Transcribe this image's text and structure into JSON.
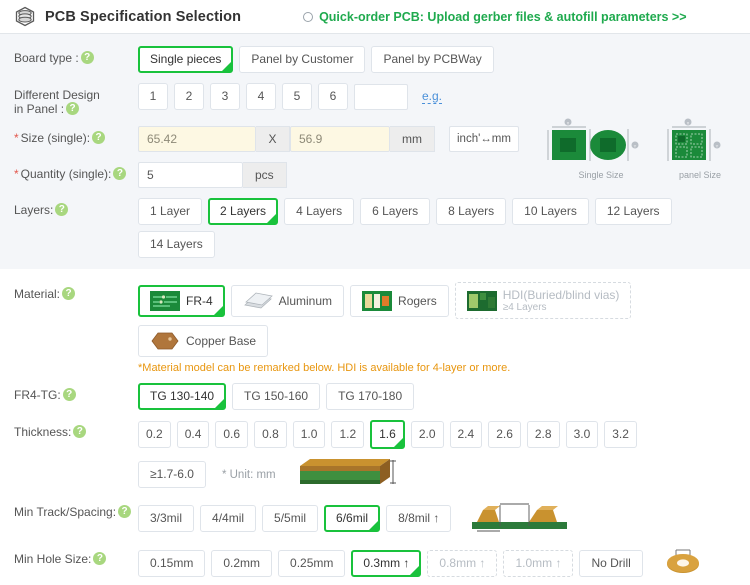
{
  "header": {
    "icon": "pcb-layers-icon",
    "title": "PCB Specification Selection",
    "quick_order": "Quick-order PCB: Upload gerber files & autofill parameters >>",
    "quick_order_selected": false
  },
  "colors": {
    "accent_green": "#19c23c",
    "link_green": "#1faa4e",
    "note_orange": "#e8960f",
    "help_green": "#a8d77f",
    "required_red": "#e2574c",
    "section_bg": "#f4f6f9",
    "input_cream": "#fdf8e3",
    "link_blue": "#4a90d9"
  },
  "rows": {
    "board_type": {
      "label": "Board type :",
      "help": "help-icon",
      "options": [
        "Single pieces",
        "Panel by Customer",
        "Panel by PCBWay"
      ],
      "selected": "Single pieces"
    },
    "different_design": {
      "label_line1": "Different Design",
      "label_line2": "in Panel :",
      "help": "help-icon",
      "options": [
        "1",
        "2",
        "3",
        "4",
        "5",
        "6"
      ],
      "selected": "",
      "custom_value": "",
      "example_link": "e.g."
    },
    "size": {
      "label": "Size (single):",
      "required": "*",
      "help": "help-icon",
      "width_value": "65.42",
      "separator": "X",
      "height_value": "56.9",
      "unit": "mm",
      "converter": "inch'↔mm",
      "diagram_single_caption": "Single Size",
      "diagram_panel_caption": "panel Size",
      "diagram_axis_x": "X",
      "diagram_axis_y": "Y"
    },
    "quantity": {
      "label": "Quantity (single):",
      "required": "*",
      "help": "help-icon",
      "value": "5",
      "unit": "pcs"
    },
    "layers": {
      "label": "Layers:",
      "help": "help-icon",
      "options": [
        "1 Layer",
        "2 Layers",
        "4 Layers",
        "6 Layers",
        "8 Layers",
        "10 Layers",
        "12 Layers",
        "14 Layers"
      ],
      "selected": "2 Layers"
    },
    "material": {
      "label": "Material:",
      "help": "help-icon",
      "options": [
        {
          "label": "FR-4",
          "thumb": "fr4-board-icon",
          "selected": true,
          "disabled": false,
          "sub": ""
        },
        {
          "label": "Aluminum",
          "thumb": "aluminum-sheet-icon",
          "selected": false,
          "disabled": false,
          "sub": ""
        },
        {
          "label": "Rogers",
          "thumb": "rogers-board-icon",
          "selected": false,
          "disabled": false,
          "sub": ""
        },
        {
          "label": "HDI(Buried/blind vias)",
          "thumb": "hdi-board-icon",
          "selected": false,
          "disabled": true,
          "sub": "≥4 Layers"
        },
        {
          "label": "Copper Base",
          "thumb": "copper-base-icon",
          "selected": false,
          "disabled": false,
          "sub": ""
        }
      ],
      "note": "*Material model can be remarked below. HDI is available for 4-layer or more."
    },
    "fr4_tg": {
      "label": "FR4-TG:",
      "help": "help-icon",
      "options": [
        "TG 130-140",
        "TG 150-160",
        "TG 170-180"
      ],
      "selected": "TG 130-140"
    },
    "thickness": {
      "label": "Thickness:",
      "help": "help-icon",
      "options": [
        "0.2",
        "0.4",
        "0.6",
        "0.8",
        "1.0",
        "1.2",
        "1.6",
        "2.0",
        "2.4",
        "2.6",
        "2.8",
        "3.0",
        "3.2"
      ],
      "selected": "1.6",
      "extra_option": "≥1.7-6.0",
      "unit_note": "* Unit: mm",
      "diagram": "pcb-thickness-diagram"
    },
    "min_track": {
      "label": "Min Track/Spacing:",
      "help": "help-icon",
      "options": [
        {
          "label": "3/3mil",
          "disabled": false
        },
        {
          "label": "4/4mil",
          "disabled": false
        },
        {
          "label": "5/5mil",
          "disabled": false
        },
        {
          "label": "6/6mil",
          "disabled": false
        },
        {
          "label": "8/8mil ↑",
          "disabled": false
        }
      ],
      "selected": "6/6mil",
      "diagram": "track-spacing-diagram"
    },
    "min_hole": {
      "label": "Min Hole Size:",
      "help": "help-icon",
      "options": [
        {
          "label": "0.15mm",
          "disabled": false
        },
        {
          "label": "0.2mm",
          "disabled": false
        },
        {
          "label": "0.25mm",
          "disabled": false
        },
        {
          "label": "0.3mm ↑",
          "disabled": false
        },
        {
          "label": "0.8mm ↑",
          "disabled": true
        },
        {
          "label": "1.0mm ↑",
          "disabled": true
        },
        {
          "label": "No Drill",
          "disabled": false
        }
      ],
      "selected": "0.3mm ↑",
      "diagram": "drill-hole-diagram"
    }
  }
}
